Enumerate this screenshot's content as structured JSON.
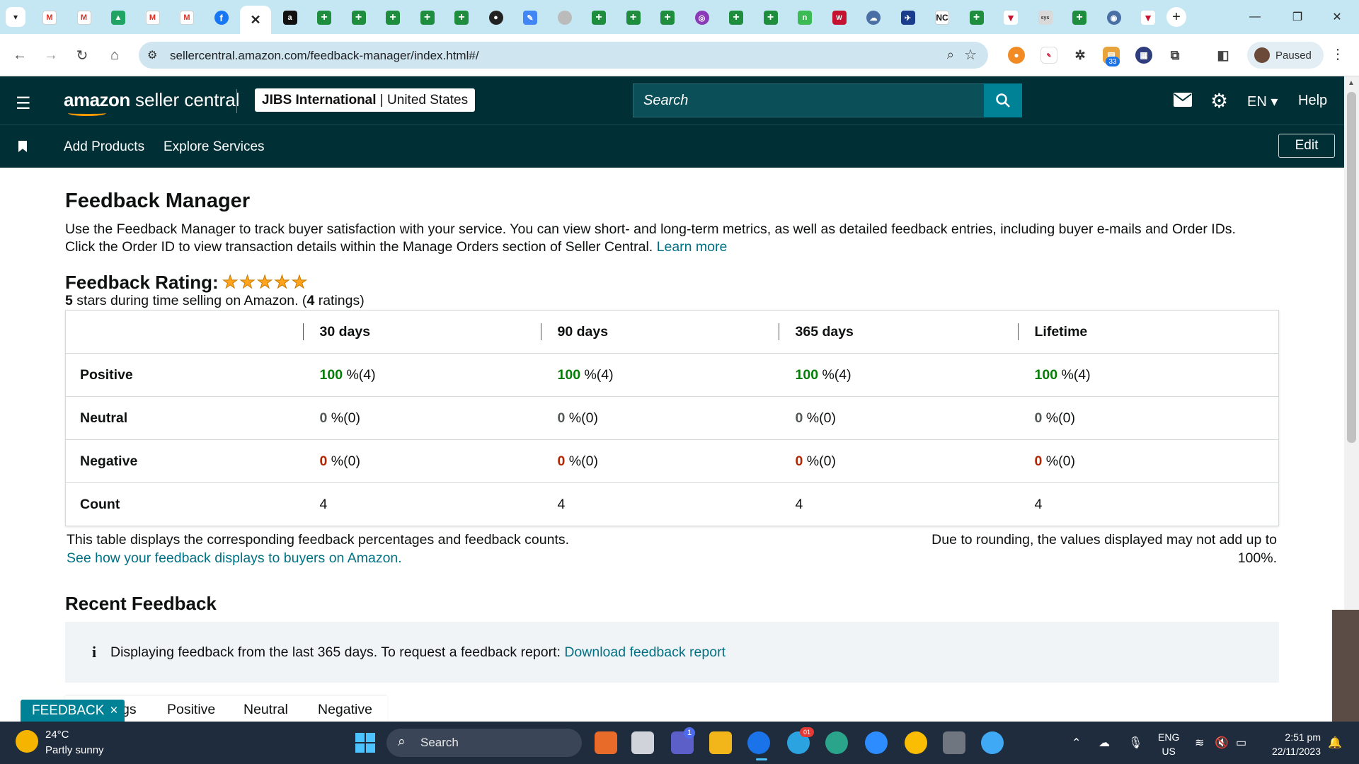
{
  "browser": {
    "url": "sellercentral.amazon.com/feedback-manager/index.html#/",
    "profile_label": "Paused",
    "extension_badge": "33",
    "tab_icons": [
      "gmail-icon",
      "gmail-icon",
      "drive-icon",
      "gmail-icon",
      "gmail-icon",
      "facebook-icon",
      "close-icon",
      "amazon-icon",
      "plus-icon",
      "plus-icon",
      "plus-icon",
      "plus-icon",
      "plus-icon",
      "circle-icon",
      "pen-icon",
      "grey-icon",
      "plus-icon",
      "plus-icon",
      "plus-icon",
      "purple-icon",
      "plus-icon",
      "plus-icon",
      "n-icon",
      "ww-icon",
      "cloud-icon",
      "bird-icon",
      "nc-icon",
      "plus-icon",
      "triangle-icon",
      "sysco-icon",
      "plus-icon",
      "badge-icon",
      "triangle-icon"
    ]
  },
  "header": {
    "brand_bold": "amazon",
    "brand_rest": " seller central",
    "account_name": "JIBS International",
    "account_sep": " | ",
    "account_region": "United States",
    "search_placeholder": "Search",
    "lang": "EN",
    "help": "Help"
  },
  "subnav": {
    "items": [
      "Add Products",
      "Explore Services"
    ],
    "edit": "Edit"
  },
  "page": {
    "title": "Feedback Manager",
    "intro": "Use the Feedback Manager to track buyer satisfaction with your service. You can view short- and long-term metrics, as well as detailed feedback entries, including buyer e-mails and Order IDs. Click the Order ID to view transaction details within the Manage Orders section of Seller Central.",
    "learn_more": "Learn more",
    "rating_title": "Feedback Rating:",
    "rating_stars": 5,
    "rating_value": "5",
    "rating_text_1": " stars during time selling on Amazon. (",
    "rating_count": "4",
    "rating_text_2": " ratings)"
  },
  "feedback_table": {
    "columns": [
      "30 days",
      "90 days",
      "365 days",
      "Lifetime"
    ],
    "rows": [
      {
        "label": "Positive",
        "type": "pos",
        "cells": [
          {
            "pct": "100",
            "rest": " %(4)"
          },
          {
            "pct": "100",
            "rest": " %(4)"
          },
          {
            "pct": "100",
            "rest": " %(4)"
          },
          {
            "pct": "100",
            "rest": " %(4)"
          }
        ]
      },
      {
        "label": "Neutral",
        "type": "neu",
        "cells": [
          {
            "pct": "0",
            "rest": " %(0)"
          },
          {
            "pct": "0",
            "rest": " %(0)"
          },
          {
            "pct": "0",
            "rest": " %(0)"
          },
          {
            "pct": "0",
            "rest": " %(0)"
          }
        ]
      },
      {
        "label": "Negative",
        "type": "neg",
        "cells": [
          {
            "pct": "0",
            "rest": " %(0)"
          },
          {
            "pct": "0",
            "rest": " %(0)"
          },
          {
            "pct": "0",
            "rest": " %(0)"
          },
          {
            "pct": "0",
            "rest": " %(0)"
          }
        ]
      },
      {
        "label": "Count",
        "type": "count",
        "cells": [
          {
            "pct": "",
            "rest": "4"
          },
          {
            "pct": "",
            "rest": "4"
          },
          {
            "pct": "",
            "rest": "4"
          },
          {
            "pct": "",
            "rest": "4"
          }
        ]
      }
    ],
    "note_left": "This table displays the corresponding feedback percentages and feedback counts.",
    "note_link": "See how your feedback displays to buyers on Amazon.",
    "note_right": "Due to rounding, the values displayed may not add up to 100%."
  },
  "recent": {
    "title": "Recent Feedback",
    "info_icon": "i",
    "info_text": "Displaying feedback from the last 365 days. To request a feedback report: ",
    "info_link": "Download feedback report",
    "tabs": [
      "gs",
      "Positive",
      "Neutral",
      "Negative"
    ]
  },
  "feedback_pill": {
    "label": "FEEDBACK",
    "close": "×"
  },
  "taskbar": {
    "temp": "24°C",
    "weather": "Partly sunny",
    "search": "Search",
    "lang_1": "ENG",
    "lang_2": "US",
    "time": "2:51 pm",
    "date": "22/11/2023",
    "chat_badge": "1",
    "telegram_badge": "01"
  },
  "colors": {
    "header_bg": "#002f36",
    "positive": "#067d06",
    "negative": "#b12704",
    "link": "#007185",
    "feedback_pill": "#008296"
  }
}
